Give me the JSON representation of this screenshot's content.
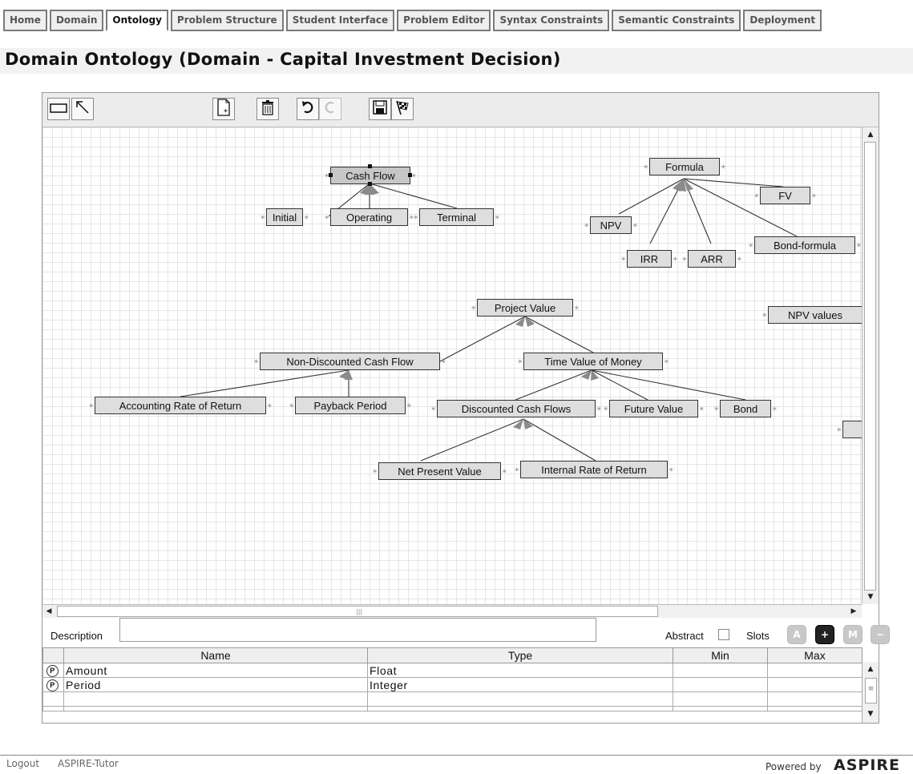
{
  "tabs": [
    "Home",
    "Domain",
    "Ontology",
    "Problem Structure",
    "Student Interface",
    "Problem Editor",
    "Syntax Constraints",
    "Semantic Constraints",
    "Deployment"
  ],
  "active_tab": "Ontology",
  "page_title": "Domain Ontology (Domain - Capital Investment Decision)",
  "toolbar_icons": [
    "rectangle-tool-icon",
    "pointer-arrow-icon",
    "new-document-icon",
    "trash-icon",
    "undo-icon",
    "redo-icon",
    "save-icon",
    "checkered-flag-icon"
  ],
  "ontology": {
    "concepts": {
      "cash_flow": "Cash Flow",
      "initial": "Initial",
      "operating": "Operating",
      "terminal": "Terminal",
      "formula": "Formula",
      "fv": "FV",
      "npv": "NPV",
      "irr": "IRR",
      "arr": "ARR",
      "bond_formula": "Bond-formula",
      "project_value": "Project Value",
      "npv_values": "NPV values",
      "non_discounted": "Non-Discounted Cash Flow",
      "time_value": "Time Value of Money",
      "accounting_rate": "Accounting Rate of Return",
      "payback_period": "Payback Period",
      "discounted_cash_flows": "Discounted Cash Flows",
      "future_value": "Future Value",
      "bond": "Bond",
      "net_present_value": "Net Present Value",
      "internal_rate": "Internal Rate of Return"
    },
    "selected": "Cash Flow"
  },
  "details": {
    "description_label": "Description",
    "description_value": "",
    "abstract_label": "Abstract",
    "abstract_checked": false,
    "slots_label": "Slots",
    "slot_buttons": [
      "A",
      "+",
      "M",
      "−"
    ]
  },
  "slots_table": {
    "headers": [
      "Name",
      "Type",
      "Min",
      "Max"
    ],
    "rows": [
      {
        "icon": "P",
        "name": "Amount",
        "type": "Float",
        "min": "",
        "max": ""
      },
      {
        "icon": "P",
        "name": "Period",
        "type": "Integer",
        "min": "",
        "max": ""
      }
    ]
  },
  "footer": {
    "logout": "Logout",
    "app": "ASPIRE-Tutor",
    "powered": "Powered by",
    "logo": "ASPIRE"
  }
}
